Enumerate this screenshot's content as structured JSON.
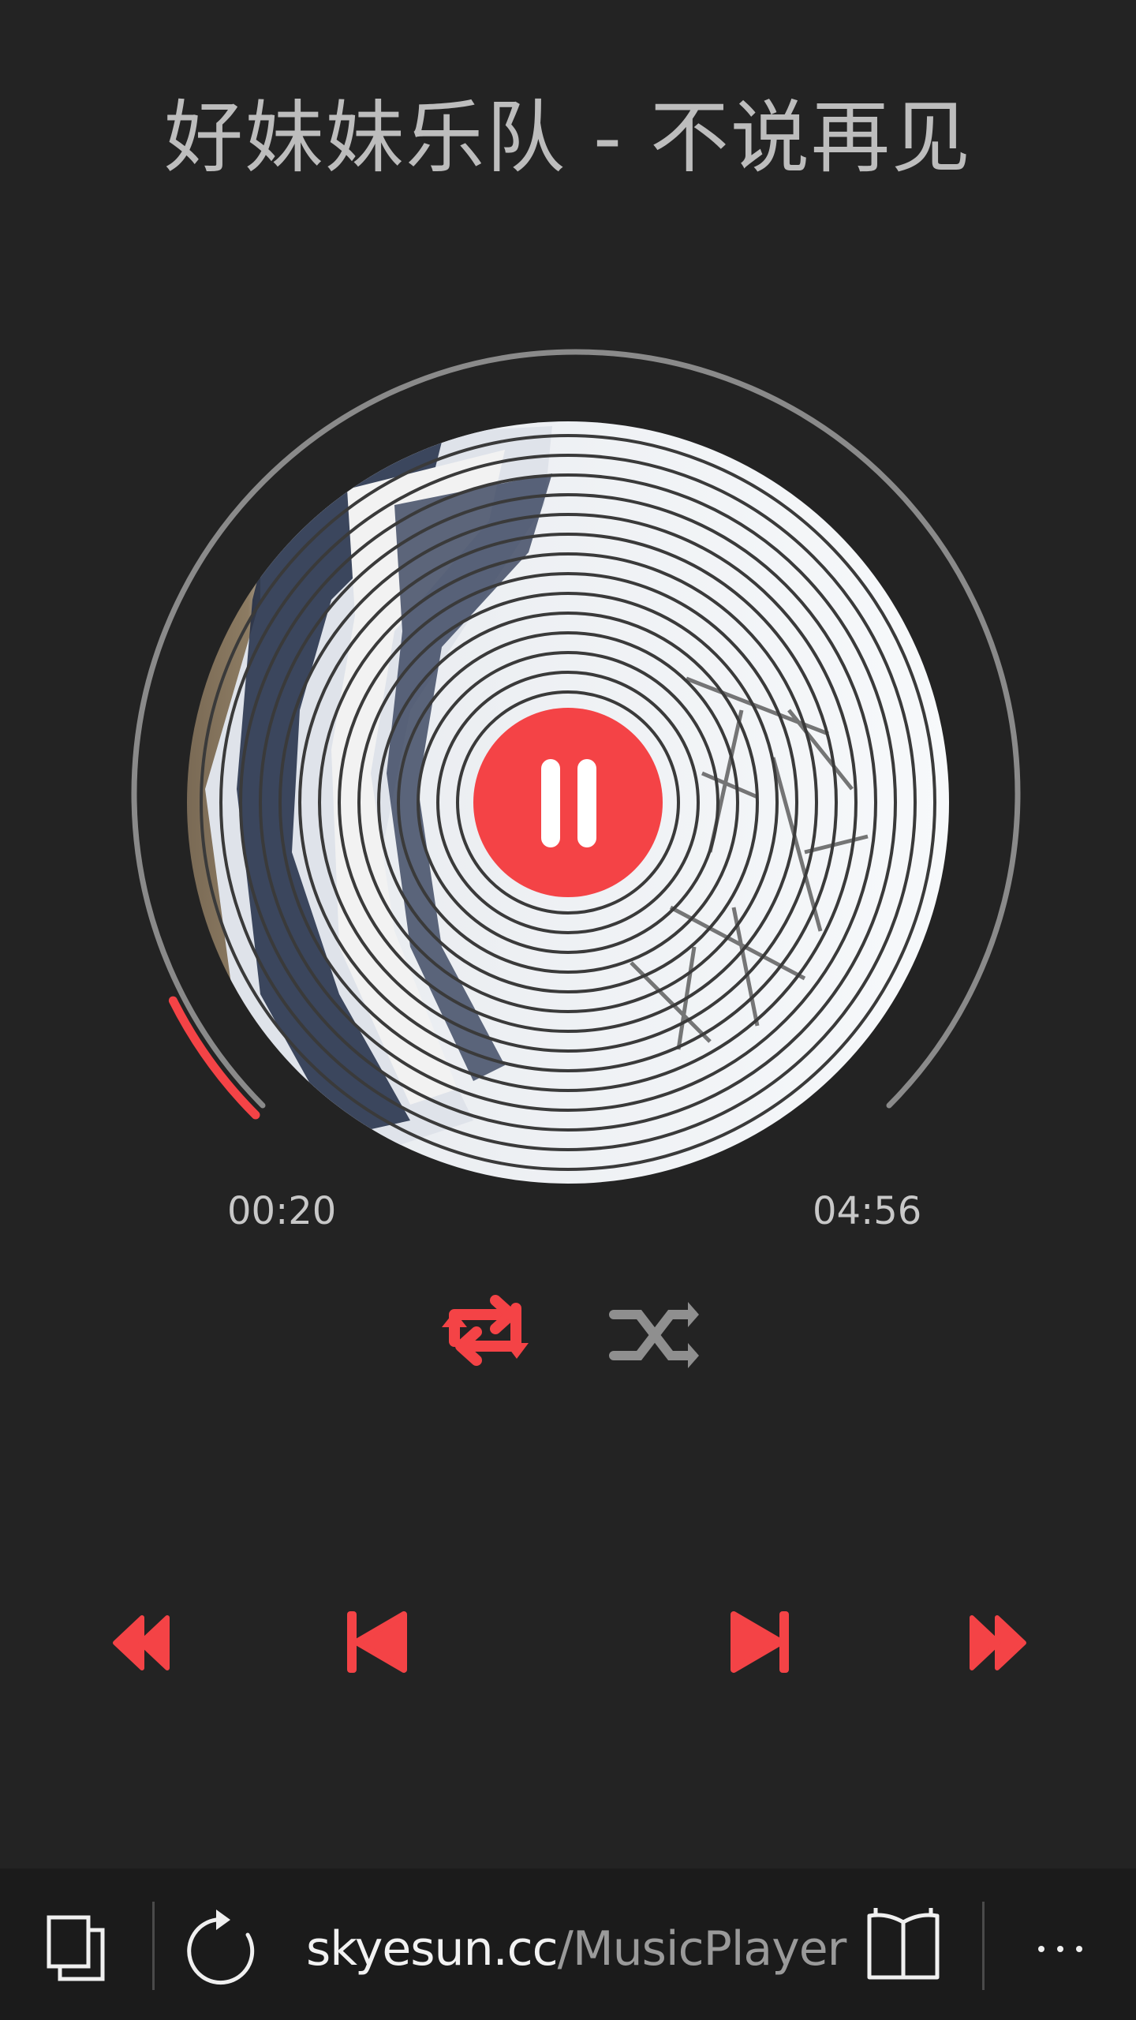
{
  "song": {
    "title": "好妹妹乐队 - 不说再见",
    "elapsed": "00:20",
    "total": "04:56",
    "progress_fraction": 0.068
  },
  "colors": {
    "accent": "#f44346",
    "background": "#232323",
    "track": "#8a8a8a",
    "text": "#c8c8c8"
  },
  "controls": {
    "play_state": "playing",
    "center_button_icon": "pause-icon",
    "repeat_icon": "repeat-icon",
    "repeat_active": true,
    "shuffle_icon": "shuffle-icon",
    "shuffle_active": false,
    "transport_icons": [
      "rewind-icon",
      "previous-track-icon",
      "next-track-icon",
      "fast-forward-icon"
    ]
  },
  "browser_bar": {
    "url_host": "skyesun.cc",
    "url_path": "/MusicPlayer",
    "icons": [
      "tabs-icon",
      "refresh-icon",
      "reading-view-icon",
      "more-icon"
    ]
  }
}
